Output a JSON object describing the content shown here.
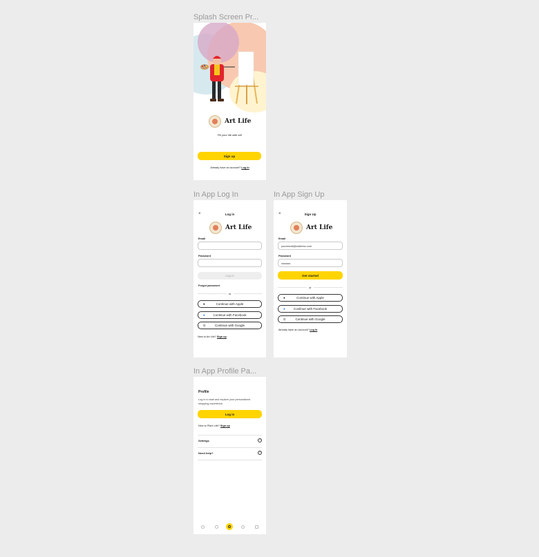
{
  "labels": {
    "splash": "Splash Screen Pr...",
    "login": "In App Log In",
    "signup": "In App Sign Up",
    "profile": "In App Profile Pa..."
  },
  "brand": {
    "name": "Art Life",
    "tagline": "Fill your life with art!"
  },
  "splash": {
    "signup_button": "Sign up",
    "account_prompt": "Already have an account?",
    "login_link": "Log In"
  },
  "login": {
    "title": "Log in",
    "close_icon": "close-icon",
    "email_label": "Email",
    "email_value": "",
    "password_label": "Password",
    "password_value": "",
    "login_button": "Log in",
    "forgot": "Forgot password",
    "or": "or",
    "apple": "Continue with Apple",
    "facebook": "Continue with Facebook",
    "google": "Continue with Google",
    "new_prompt": "New to Art Life?",
    "signup_link": "Sign up"
  },
  "signup": {
    "title": "Sign Up",
    "email_label": "Email",
    "email_value": "youremail@address.com",
    "password_label": "Password",
    "password_value": "••••••••••••",
    "get_started": "Get started",
    "or": "or",
    "apple": "Continue with Apple",
    "facebook": "Continue with Facebook",
    "google": "Continue with Google",
    "have_account": "Already have an account?",
    "login_link": "Log In"
  },
  "profile": {
    "title": "Profile",
    "description": "Log in to start and explore your personalized shopping experience.",
    "login_button": "Log in",
    "new_prompt": "New to Plant Life?",
    "signup_link": "Sign up",
    "settings": "Settings",
    "help": "Need help?",
    "nav": [
      "home-icon",
      "heart-icon",
      "profile-icon",
      "tag-icon",
      "bag-icon"
    ]
  },
  "colors": {
    "accent": "#ffd400",
    "background": "#ececec"
  }
}
